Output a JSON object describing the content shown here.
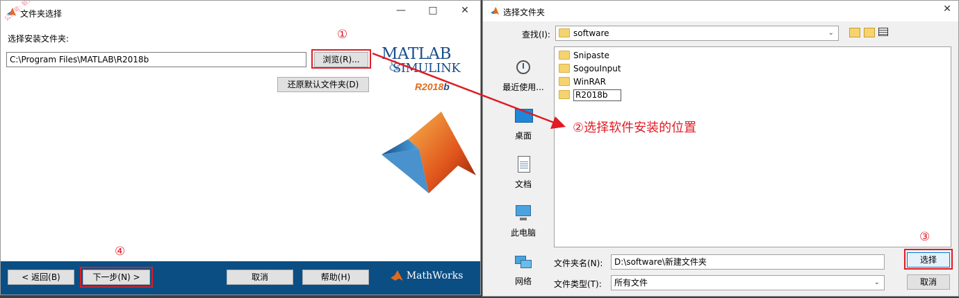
{
  "left_window": {
    "title": "文件夹选择",
    "watermark": "公众号: 软件管家",
    "install_label": "选择安装文件夹:",
    "path_value": "C:\\Program Files\\MATLAB\\R2018b",
    "browse_label": "浏览(R)...",
    "restore_label": "还原默认文件夹(D)",
    "logo_line1": "MATLAB",
    "logo_amp": "&",
    "logo_line2": "SIMULINK",
    "release_r": "R2018",
    "release_b": "b",
    "back_label": "< 返回(B)",
    "next_label": "下一步(N) >",
    "cancel_label": "取消",
    "help_label": "帮助(H)",
    "mathworks_label": "MathWorks",
    "colors": {
      "footer": "#0b4e84",
      "accent": "#e01b24"
    }
  },
  "annotations": {
    "step1": "①",
    "step2": "②选择软件安装的位置",
    "step3": "③",
    "step4": "④"
  },
  "right_window": {
    "title": "选择文件夹",
    "lookin_label": "查找(I):",
    "lookin_value": "software",
    "nav_items": [
      {
        "label": "最近使用...",
        "icon": "recent-icon"
      },
      {
        "label": "桌面",
        "icon": "desktop-icon"
      },
      {
        "label": "文档",
        "icon": "documents-icon"
      },
      {
        "label": "此电脑",
        "icon": "computer-icon"
      },
      {
        "label": "网络",
        "icon": "network-icon"
      }
    ],
    "files": [
      "Snipaste",
      "SogouInput",
      "WinRAR",
      "R2018b"
    ],
    "foldername_label": "文件夹名(N):",
    "foldername_value": "D:\\software\\新建文件夹",
    "filetype_label": "文件类型(T):",
    "filetype_value": "所有文件",
    "select_label": "选择",
    "cancel_label": "取消"
  }
}
